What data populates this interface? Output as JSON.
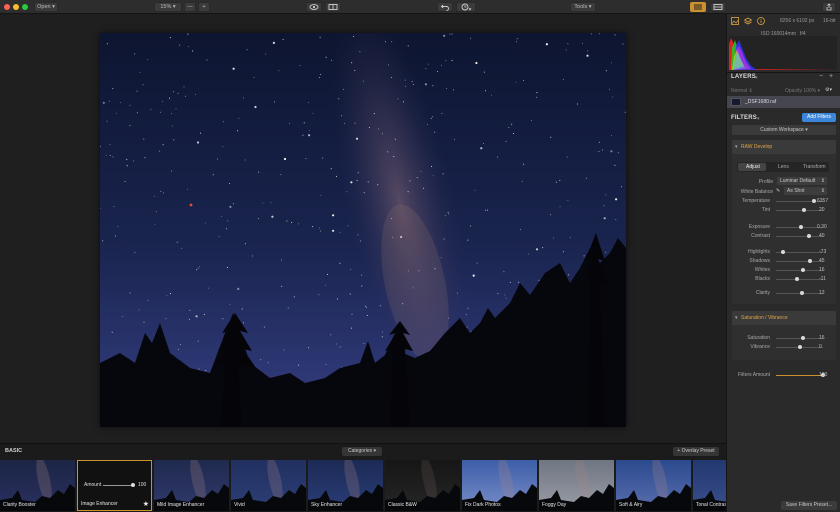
{
  "toolbar": {
    "open_label": "Open",
    "zoom_value": "15%",
    "zoom_minus": "—",
    "zoom_plus": "+",
    "tools_label": "Tools"
  },
  "image_info": {
    "dimensions": "8256 x 6192 px",
    "bit_depth": "16-bit",
    "iso": "ISO 1600",
    "focal": "14mm",
    "aperture": "f/4"
  },
  "layers": {
    "title": "LAYERS",
    "blend_mode": "Normal",
    "opacity_label": "Opacity",
    "opacity_value": "100%",
    "layer_name": "_DSF1680.raf"
  },
  "filters": {
    "title": "FILTERS",
    "add_button": "Add Filters",
    "workspace": "Custom Workspace",
    "raw_develop": "RAW Develop",
    "tabs": [
      "Adjust",
      "Lens",
      "Transform"
    ],
    "profile_label": "Profile",
    "profile_value": "Luminar Default",
    "wb_label": "White Balance",
    "wb_value": "As Shot",
    "sliders": [
      {
        "label": "Temperature",
        "value": "6357",
        "pos": 0.8
      },
      {
        "label": "Tint",
        "value": "20",
        "pos": 0.6
      },
      {
        "label": "Exposure",
        "value": "0.30",
        "pos": 0.53
      },
      {
        "label": "Contrast",
        "value": "40",
        "pos": 0.7
      },
      {
        "label": "Highlights",
        "value": "-73",
        "pos": 0.14
      },
      {
        "label": "Shadows",
        "value": "45",
        "pos": 0.72
      },
      {
        "label": "Whites",
        "value": "16",
        "pos": 0.58
      },
      {
        "label": "Blacks",
        "value": "-11",
        "pos": 0.45
      },
      {
        "label": "Clarity",
        "value": "13",
        "pos": 0.56
      }
    ],
    "sat_section": "Saturation / Vibrance",
    "sat_sliders": [
      {
        "label": "Saturation",
        "value": "16",
        "pos": 0.58
      },
      {
        "label": "Vibrance",
        "value": "0",
        "pos": 0.5
      }
    ],
    "amount_label": "Filters Amount",
    "amount_value": "100",
    "amount_pos": 1.0,
    "save_preset": "Save Filters Preset..."
  },
  "presets": {
    "category": "BASIC",
    "categories_label": "Categories",
    "overlay_label": "+ Overlay Preset",
    "amount_label": "Amount",
    "amount_value": "100",
    "items": [
      "Clarity Booster",
      "Image Enhancer",
      "Mild Image Enhancer",
      "Vivid",
      "Sky Enhancer",
      "Classic B&W",
      "Fix Dark Photos",
      "Foggy Day",
      "Soft & Airy",
      "Tonal Contrast"
    ]
  },
  "colors": {
    "accent": "#c9922e",
    "blue": "#3b86d8",
    "section_text": "#e0a444"
  }
}
